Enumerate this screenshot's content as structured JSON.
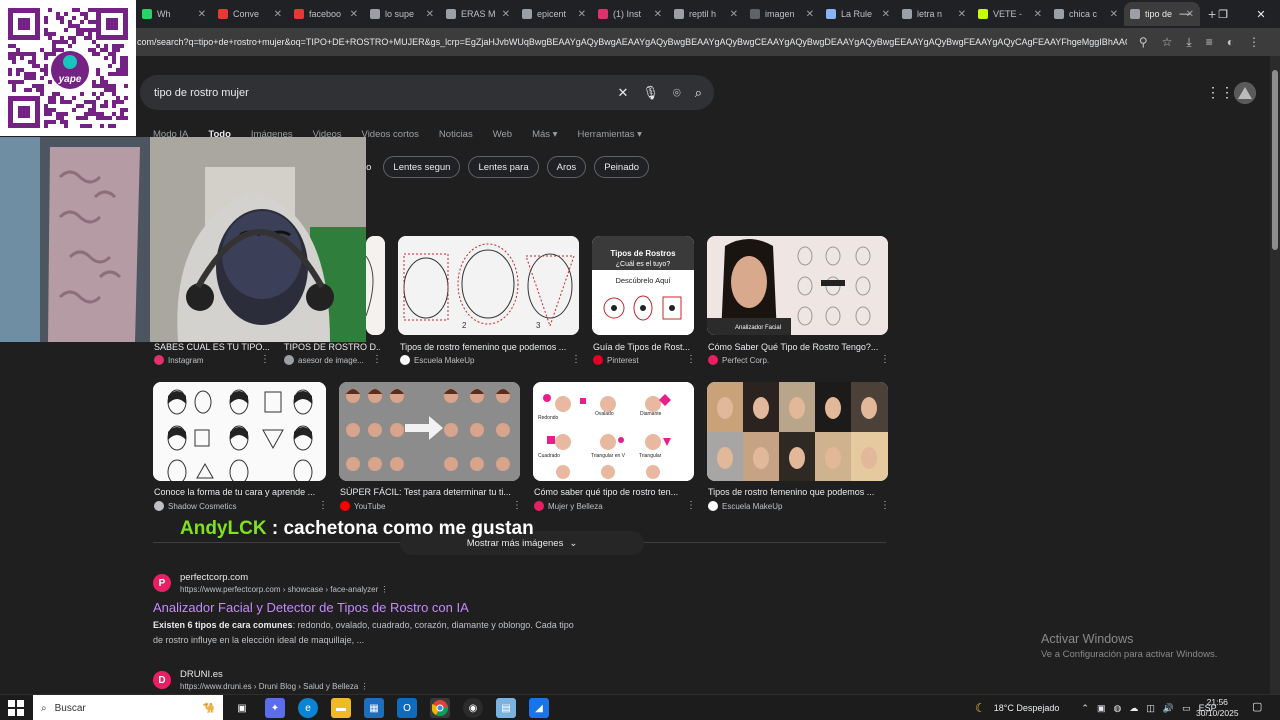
{
  "browser": {
    "tabs": [
      {
        "title": "Wh",
        "color": "#25d366"
      },
      {
        "title": "Conve",
        "color": "#e53935"
      },
      {
        "title": "faceboo",
        "color": "#e53935"
      },
      {
        "title": "lo supe",
        "color": "#9aa0a6"
      },
      {
        "title": "ERAS M",
        "color": "#9aa0a6"
      },
      {
        "title": "epicent",
        "color": "#9aa0a6"
      },
      {
        "title": "(1) Inst",
        "color": "#e1306c"
      },
      {
        "title": "reptil h",
        "color": "#9aa0a6"
      },
      {
        "title": "imagen",
        "color": "#5f6368"
      },
      {
        "title": "La Rule",
        "color": "#8ab4f8"
      },
      {
        "title": "letra n",
        "color": "#9aa0a6"
      },
      {
        "title": "VETE -",
        "color": "#c6ff00"
      },
      {
        "title": "chica c",
        "color": "#9aa0a6"
      },
      {
        "title": "tipo de",
        "color": "#9aa0a6",
        "active": true
      }
    ],
    "url": "com/search?q=tipo+de+rostro+mujer&oq=TIPO+DE+ROSTRO+MUJER&gs_lcrp=EgZjaHJvbWUqBwgBEAAYgAQyBwgAEAAYgAQyBwgBEAAYgAQyBwgCEAAYgAQyBwgDEAAYgAQyBwgEEAAYgAQyBwgFEAAYgAQyCAgFEAAYFhgeMggIBhAAGBYYHjIICAcQAB"
  },
  "search": {
    "query": "tipo de rostro mujer",
    "tabs": [
      "Modo IA",
      "Todo",
      "Imágenes",
      "Videos",
      "Videos cortos",
      "Noticias",
      "Web",
      "Más",
      "Herramientas"
    ],
    "chips": [
      "Lentes segun",
      "Lentes para",
      "Aros",
      "Peinado"
    ],
    "chip_partial": "jo",
    "more_images": "Mostrar más imágenes"
  },
  "images_row1": [
    {
      "caption": "SABES CUAL ES TU TIPO...",
      "source": "Instagram",
      "src_color": "#e1306c"
    },
    {
      "caption": "TIPOS DE ROSTRO D...",
      "source": "asesor de image...",
      "src_color": "#9aa0a6"
    },
    {
      "caption": "Tipos de rostro femenino que podemos ...",
      "source": "Escuela MakeUp",
      "src_color": "#ffffff"
    },
    {
      "caption": "Guía de Tipos de Rost...",
      "source": "Pinterest",
      "src_color": "#e60023",
      "title1": "Tipos de Rostros",
      "title2": "¿Cuál es el tuyo?",
      "title3": "Descúbrelo Aquí"
    },
    {
      "caption": "Cómo Saber Qué Tipo de Rostro Tengo?...",
      "source": "Perfect Corp.",
      "src_color": "#e91e63",
      "badge": "Analizador Facial"
    }
  ],
  "images_row2": [
    {
      "caption": "Conoce la forma de tu cara y aprende ...",
      "source": "Shadow Cosmetics",
      "src_color": "#bdc1c6"
    },
    {
      "caption": "SÚPER FÁCIL: Test para determinar tu ti...",
      "source": "YouTube",
      "src_color": "#ff0000"
    },
    {
      "caption": "Cómo saber qué tipo de rostro ten...",
      "source": "Mujer y Belleza",
      "src_color": "#e91e63",
      "labels": [
        "Redondo",
        "Ovalado",
        "Diamante",
        "Cuadrado",
        "Triangular en V",
        "Triangular"
      ]
    },
    {
      "caption": "Tipos de rostro femenino que podemos ...",
      "source": "Escuela MakeUp",
      "src_color": "#ffffff"
    }
  ],
  "chat": {
    "user": "AndyLCK",
    "message": ": cachetona como me gustan"
  },
  "results": [
    {
      "site": "perfectcorp.com",
      "crumb": "https://www.perfectcorp.com › showcase › face-analyzer",
      "title": "Analizador Facial y Detector de Tipos de Rostro con IA",
      "snippet_bold": "Existen 6 tipos de cara comunes",
      "snippet": ": redondo, ovalado, cuadrado, corazón, diamante y oblongo. Cada tipo de rostro influye en la elección ideal de maquillaje, ...",
      "icon": "P",
      "icon_color": "#e91e63"
    },
    {
      "site": "DRUNI.es",
      "crumb": "https://www.druni.es › Druni Blog › Salud y Belleza",
      "icon": "D",
      "icon_color": "#e91e63"
    }
  ],
  "watermark": {
    "line1": "Activar Windows",
    "line2": "Ve a Configuración para activar Windows."
  },
  "qr": {
    "brand": "yape",
    "color": "#742284"
  },
  "taskbar": {
    "search": "Buscar",
    "weather": "18°C  Despejado",
    "lang": "ESP",
    "time": "21:56",
    "date": "30/10/2025"
  }
}
